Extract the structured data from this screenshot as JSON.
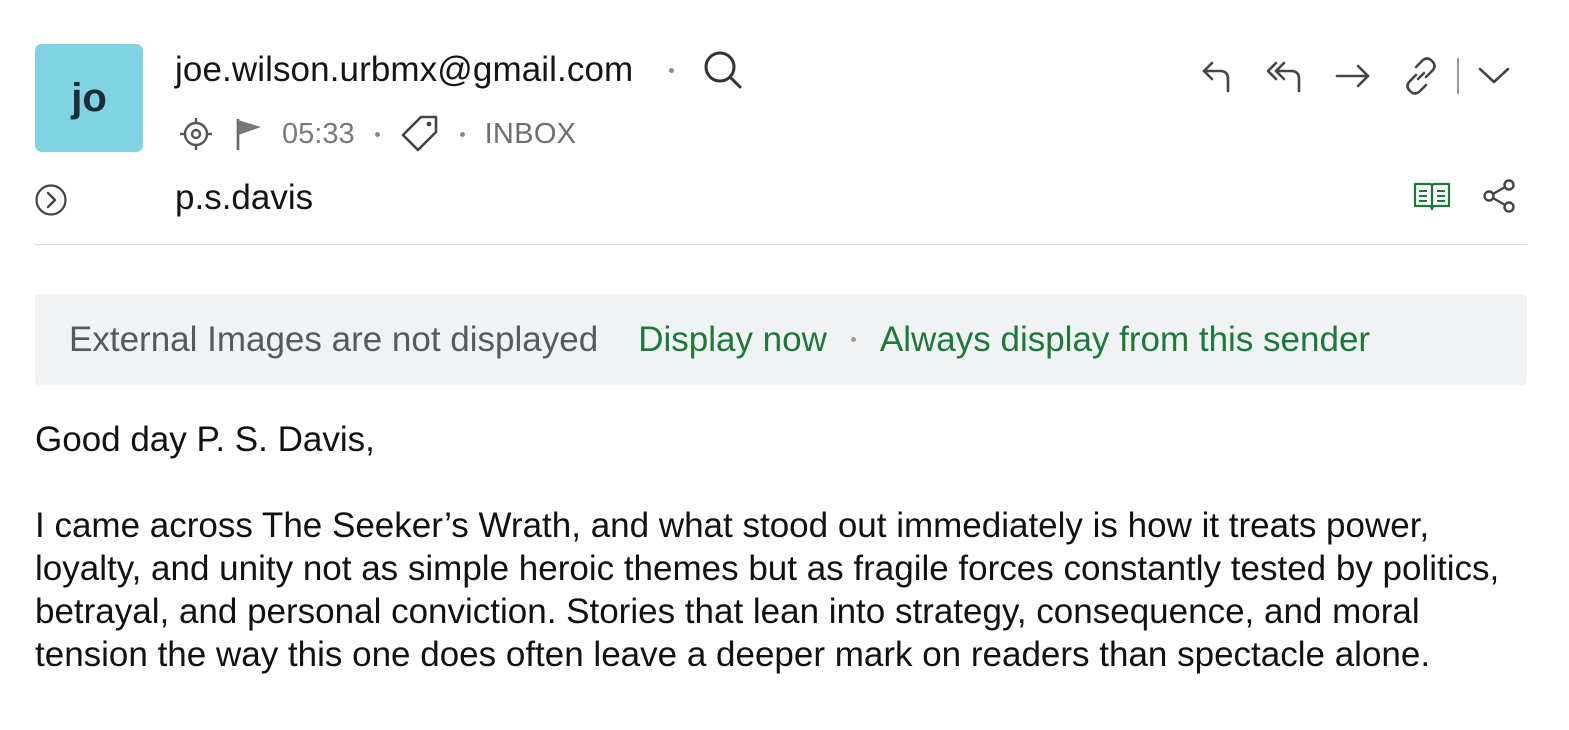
{
  "avatar": {
    "initials": "jo",
    "color": "#7fd3e3"
  },
  "sender": {
    "email": "joe.wilson.urbmx@gmail.com"
  },
  "meta": {
    "time": "05:33",
    "folder": "INBOX"
  },
  "recipient": {
    "name": "p.s.davis"
  },
  "icons": {
    "search": "search-icon",
    "target": "crosshair-icon",
    "flag": "flag-icon",
    "tag": "tag-icon",
    "expand": "chevron-right-circle-icon",
    "reply": "reply-icon",
    "reply_all": "reply-all-icon",
    "forward": "forward-icon",
    "link": "link-icon",
    "more": "chevron-down-icon",
    "reader": "book-open-icon",
    "share": "share-icon"
  },
  "banner": {
    "text": "External Images are not displayed",
    "display_now": "Display now",
    "always_display": "Always display from this sender"
  },
  "message": {
    "greeting": "Good day P. S. Davis,",
    "paragraph": "I came across The Seeker’s Wrath, and what stood out immediately is how it treats power, loyalty, and unity not as simple heroic themes but as fragile forces constantly tested by politics, betrayal, and personal conviction. Stories that lean into strategy, consequence, and moral tension the way this one does often leave a deeper mark on readers than spectacle alone."
  },
  "colors": {
    "accent_green": "#1a7a36",
    "banner_bg": "#f1f2f4",
    "muted_text": "#7a7a7a"
  }
}
